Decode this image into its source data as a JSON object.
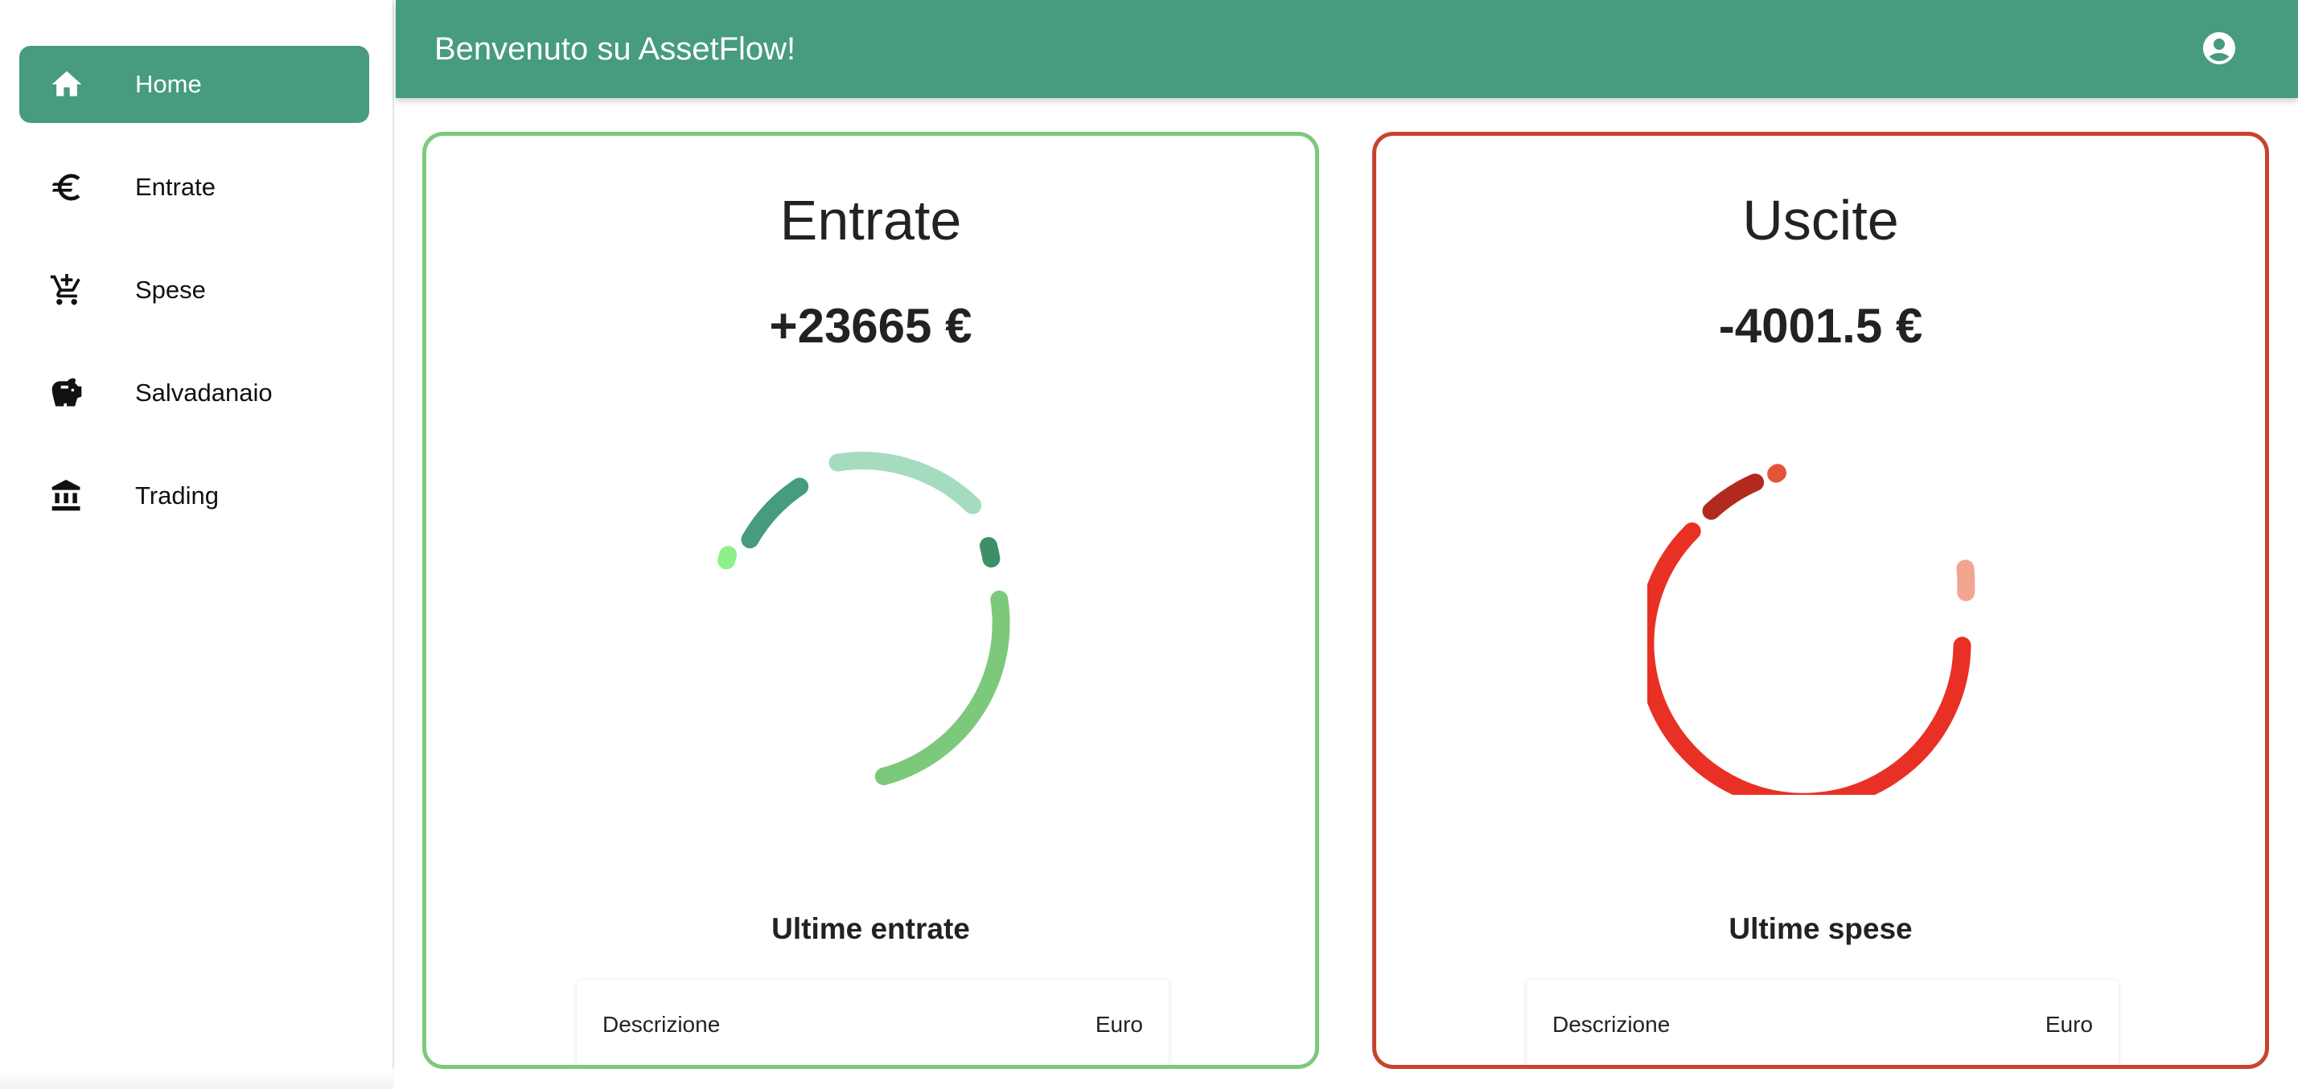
{
  "sidebar": {
    "items": [
      {
        "label": "Home",
        "icon": "home-icon",
        "active": true
      },
      {
        "label": "Entrate",
        "icon": "euro-icon",
        "active": false
      },
      {
        "label": "Spese",
        "icon": "add-cart-icon",
        "active": false
      },
      {
        "label": "Salvadanaio",
        "icon": "piggy-bank-icon",
        "active": false
      },
      {
        "label": "Trading",
        "icon": "bank-icon",
        "active": false
      }
    ]
  },
  "header": {
    "title": "Benvenuto su AssetFlow!",
    "account_icon": "account-circle-icon"
  },
  "colors": {
    "primary": "#469b80",
    "income_border": "#7dc97b",
    "expense_border": "#c8432d"
  },
  "income": {
    "title": "Entrate",
    "total": "+23665 €",
    "subtitle": "Ultime entrate",
    "table_headers": {
      "description": "Descrizione",
      "amount": "Euro"
    }
  },
  "expense": {
    "title": "Uscite",
    "total": "-4001.5 €",
    "subtitle": "Ultime spese",
    "table_headers": {
      "description": "Descrizione",
      "amount": "Euro"
    }
  }
}
